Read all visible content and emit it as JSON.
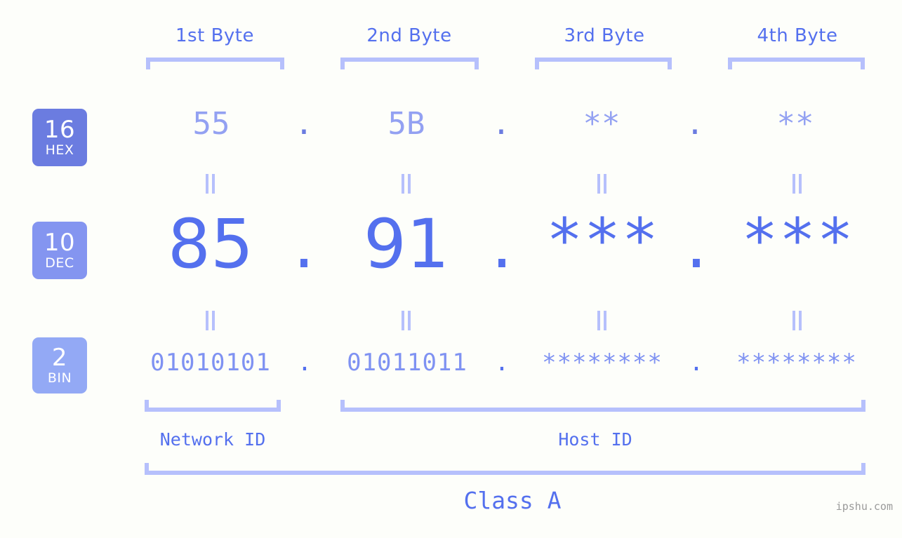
{
  "page": {
    "background_color": "#fdfefa",
    "accent_color": "#5470ee",
    "light_accent_color": "#b6c0fc",
    "watermark": "ipshu.com"
  },
  "byte_headers": [
    {
      "label": "1st Byte"
    },
    {
      "label": "2nd Byte"
    },
    {
      "label": "3rd Byte"
    },
    {
      "label": "4th Byte"
    }
  ],
  "bases": [
    {
      "number": "16",
      "name": "HEX",
      "color": "#6b7ce0"
    },
    {
      "number": "10",
      "name": "DEC",
      "color": "#8495f0"
    },
    {
      "number": "2",
      "name": "BIN",
      "color": "#93a9f5"
    }
  ],
  "rows": {
    "hex": {
      "base": "16",
      "base_name": "HEX",
      "bytes": [
        "55",
        "5B",
        "**",
        "**"
      ],
      "separator": "."
    },
    "dec": {
      "base": "10",
      "base_name": "DEC",
      "bytes": [
        "85",
        "91",
        "***",
        "***"
      ],
      "separator": "."
    },
    "bin": {
      "base": "2",
      "base_name": "BIN",
      "bytes": [
        "01010101",
        "01011011",
        "********",
        "********"
      ],
      "separator": "."
    }
  },
  "equals_separator": "=",
  "regions": [
    {
      "label": "Network ID"
    },
    {
      "label": "Host ID"
    }
  ],
  "class": {
    "label": "Class A"
  }
}
